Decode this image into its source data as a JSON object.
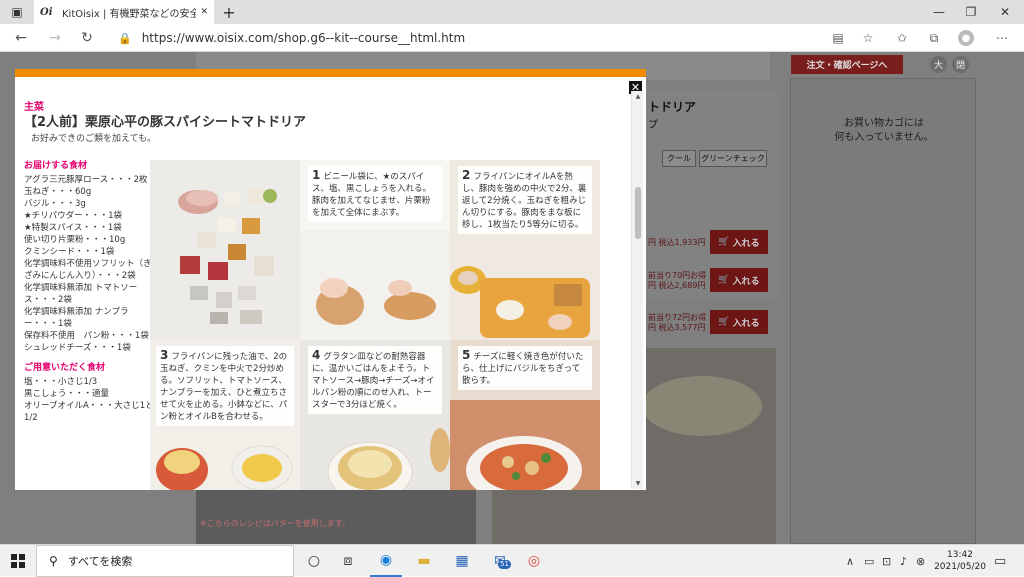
{
  "browser": {
    "tab_favicon": "Oi",
    "tab_title": "KitOisix | 有機野菜などの安全食材",
    "url": "https://www.oisix.com/shop.g6--kit--course__html.htm",
    "new_tab": "+",
    "controls": {
      "minimize": "—",
      "restore": "❐",
      "close": "✕",
      "back": "←",
      "forward": "→",
      "refresh": "↻",
      "more": "⋯"
    }
  },
  "background_page": {
    "cart_button": "注文・確認ページへ",
    "size_large": "大",
    "size_medium": "閉",
    "cart_empty": "お買い物カゴには\n何も入っていません。",
    "product_title_tail": "トドリア",
    "product_sub_tail": "プ",
    "tags": [
      "クール",
      "グリーンチェック"
    ],
    "prices": [
      {
        "text": "円 税込1,933円",
        "button": "入れる"
      },
      {
        "text": "前当り70円お得\n円 税込2,689円",
        "button": "入れる"
      },
      {
        "text": "前当り72円お得\n円 税込3,577円",
        "button": "入れる"
      }
    ],
    "butter_note": "※こちらのレシピはバターを使用します。"
  },
  "modal": {
    "label": "主菜",
    "title": "【2人前】栗原心平の豚スパイシートマトドリア",
    "subtitle": "お好みできのご類を加えても。",
    "close": "✕",
    "ingredients_heading": "お届けする食材",
    "ingredients": [
      "アグラ三元豚厚ロース・・・2枚",
      "玉ねぎ・・・60g",
      "バジル・・・3g",
      "★チリパウダー・・・1袋",
      "★特製スパイス・・・1袋",
      "使い切り片栗粉・・・10g",
      "クミンシード・・・1袋",
      "化学調味料不使用ソフリット（きざみにんじん入り）・・・2袋",
      "化学調味料無添加 トマトソース・・・2袋",
      "化学調味料無添加 ナンプラー・・・1袋",
      "保存料不使用　パン粉・・・1袋",
      "シュレッドチーズ・・・1袋"
    ],
    "pantry_heading": "ご用意いただく食材",
    "pantry": [
      "塩・・・小さじ1/3",
      "黒こしょう・・・適量",
      "オリーブオイルA・・・大さじ1と1/2"
    ],
    "steps": [
      {
        "num": "1",
        "text": "ビニール袋に、★のスパイス、塩、黒こしょうを入れる。豚肉を加えてなじませ、片栗粉を加えて全体にまぶす。"
      },
      {
        "num": "2",
        "text": "フライパンにオイルAを熱し、豚肉を強めの中火で2分、裏返して2分焼く。玉ねぎを粗みじん切りにする。豚肉をまな板に移し、1枚当たり5等分に切る。"
      },
      {
        "num": "3",
        "text": "フライパンに残った油で、2の玉ねぎ、クミンを中火で2分炒める。ソフリット、トマトソース、ナンプラーを加え、ひと煮立ちさせて火を止める。小鉢などに、パン粉とオイルBを合わせる。"
      },
      {
        "num": "4",
        "text": "グラタン皿などの耐熱容器に、温かいごはんをよそう。トマトソース→豚肉→チーズ→オイルパン粉の順にのせ入れ、トースターで3分ほど焼く。"
      },
      {
        "num": "5",
        "text": "チーズに軽く焼き色が付いたら、仕上げにバジルをちぎって散らす。"
      }
    ]
  },
  "taskbar": {
    "search_placeholder": "すべてを検索",
    "mail_badge": "51",
    "time": "13:42",
    "date": "2021/05/20"
  }
}
